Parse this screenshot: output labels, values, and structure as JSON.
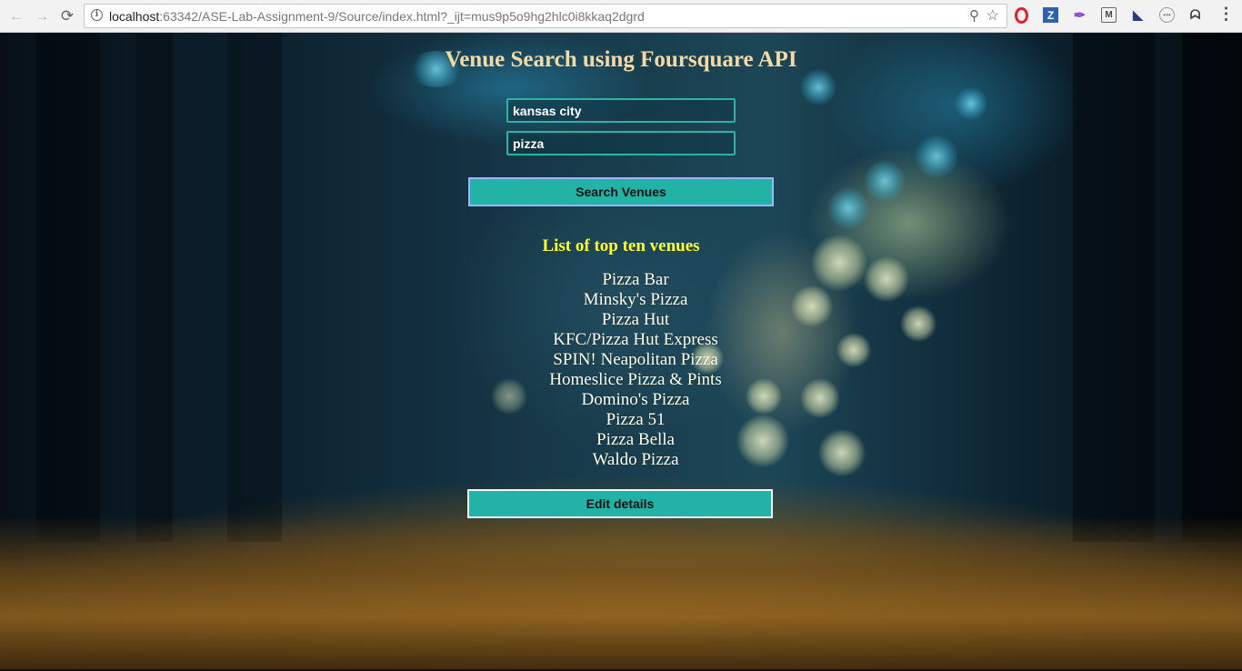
{
  "browser": {
    "url_host": "localhost",
    "url_rest": ":63342/ASE-Lab-Assignment-9/Source/index.html?_ijt=mus9p5o9hg2hlc0i8kkaq2dgrd",
    "back_icon": "←",
    "forward_icon": "→",
    "reload_icon": "⟳",
    "info_icon": "i",
    "zoom_icon": "⚲",
    "star_icon": "☆",
    "menu_icon": "⋮",
    "extensions": [
      {
        "name": "opera-icon",
        "glyph": ""
      },
      {
        "name": "z-icon",
        "glyph": "Z"
      },
      {
        "name": "pen-icon",
        "glyph": "✒"
      },
      {
        "name": "m-icon",
        "glyph": "M"
      },
      {
        "name": "flag-icon",
        "glyph": "◣"
      },
      {
        "name": "dots-icon",
        "glyph": "•••"
      },
      {
        "name": "ghost-icon",
        "glyph": "ᗣ"
      }
    ]
  },
  "page": {
    "title": "Venue Search using Foursquare API",
    "city_value": "kansas city",
    "query_value": "pizza",
    "search_label": "Search Venues",
    "list_heading": "List of top ten venues",
    "venues": [
      "Pizza Bar",
      "Minsky's Pizza",
      "Pizza Hut",
      "KFC/Pizza Hut Express",
      "SPIN! Neapolitan Pizza",
      "Homeslice Pizza & Pints",
      "Domino's Pizza",
      "Pizza 51",
      "Pizza Bella",
      "Waldo Pizza"
    ],
    "edit_label": "Edit details"
  },
  "colors": {
    "title": "#f4d9a6",
    "heading": "#ffff2e",
    "button": "#22b2a6",
    "field_border": "#29b59f"
  }
}
